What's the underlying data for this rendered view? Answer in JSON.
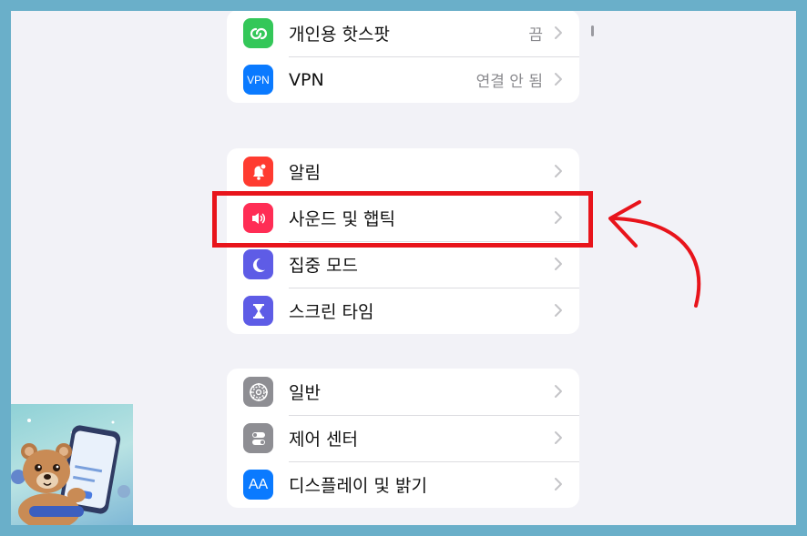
{
  "groups": [
    {
      "items": [
        {
          "label": "개인용 핫스팟",
          "value": "끔",
          "icon": "personal-hotspot-icon",
          "color": "#34c759"
        },
        {
          "label": "VPN",
          "value": "연결 안 됨",
          "icon": "vpn-icon",
          "icon_text": "VPN",
          "color": "#0a7aff"
        }
      ]
    },
    {
      "items": [
        {
          "label": "알림",
          "value": "",
          "icon": "bell-icon",
          "color": "#ff3b30"
        },
        {
          "label": "사운드 및 햅틱",
          "value": "",
          "icon": "speaker-icon",
          "color": "#ff2d55"
        },
        {
          "label": "집중 모드",
          "value": "",
          "icon": "moon-icon",
          "color": "#5e5ce6"
        },
        {
          "label": "스크린 타임",
          "value": "",
          "icon": "hourglass-icon",
          "color": "#5e5ce6"
        }
      ]
    },
    {
      "items": [
        {
          "label": "일반",
          "value": "",
          "icon": "gear-icon",
          "color": "#8e8e93"
        },
        {
          "label": "제어 센터",
          "value": "",
          "icon": "control-center-icon",
          "color": "#8e8e93"
        },
        {
          "label": "디스플레이 및 밝기",
          "value": "",
          "icon": "display-brightness-icon",
          "icon_text": "AA",
          "color": "#0a7aff"
        }
      ]
    }
  ],
  "annotation": {
    "highlight_color": "#e8141b",
    "highlighted_item": "사운드 및 햅틱"
  },
  "thumbnail": {
    "phone_text": "Vibration intensity",
    "button_text": "Change"
  }
}
